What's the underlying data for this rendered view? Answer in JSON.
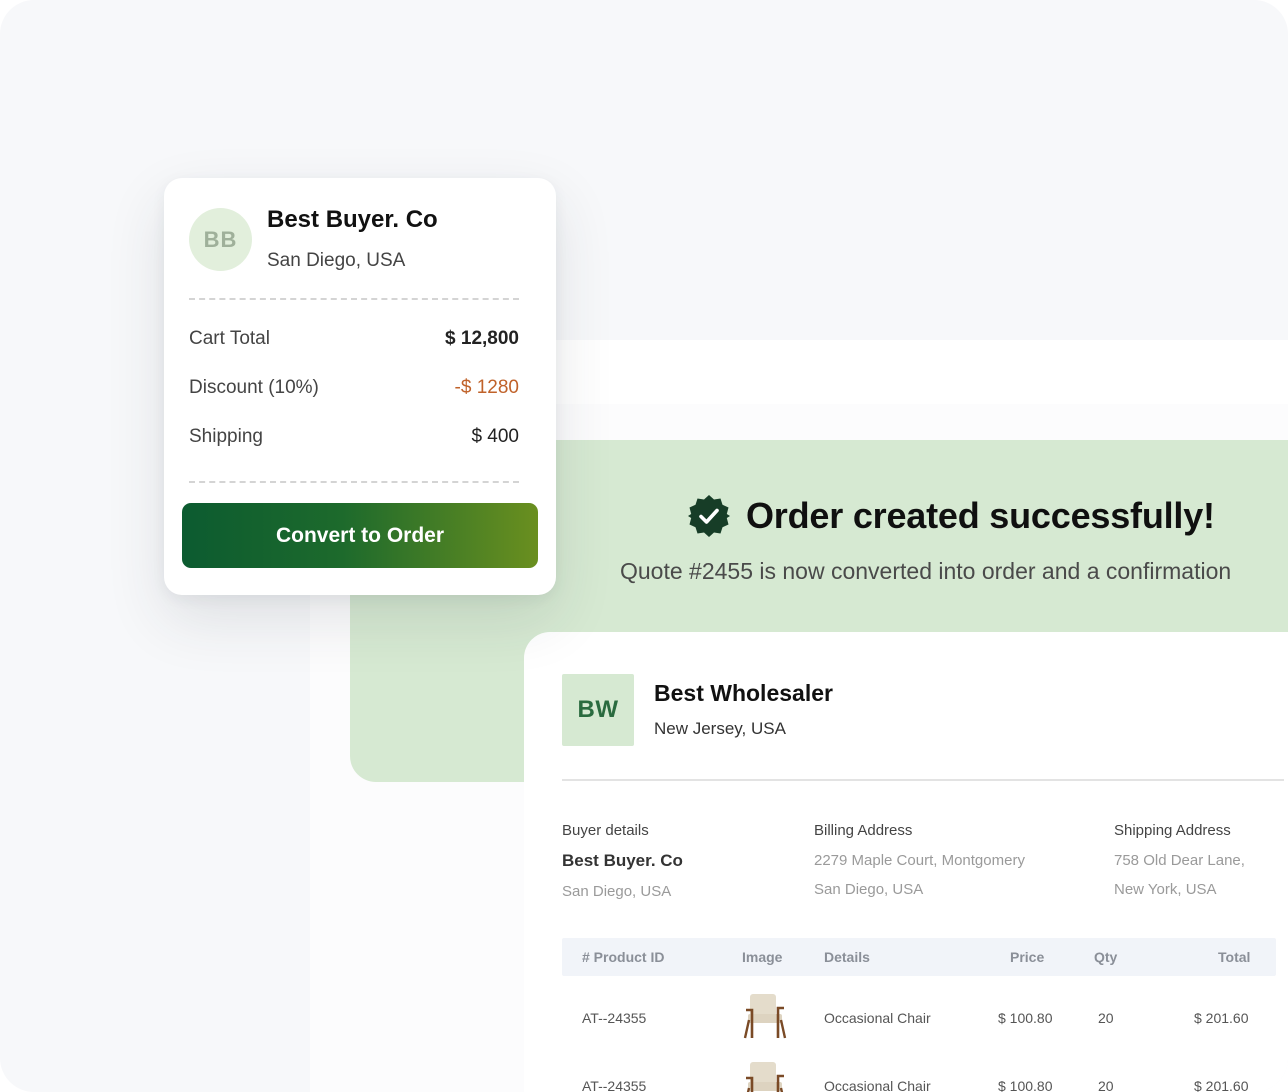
{
  "quote_card": {
    "avatar_initials": "BB",
    "buyer_name": "Best Buyer. Co",
    "buyer_location": "San Diego, USA",
    "rows": [
      {
        "label": "Cart Total",
        "value": "$ 12,800"
      },
      {
        "label": "Discount (10%)",
        "value": "-$ 1280"
      },
      {
        "label": "Shipping",
        "value": "$ 400"
      }
    ],
    "convert_button": "Convert to Order"
  },
  "banner": {
    "title": "Order created successfully!",
    "subtitle": "Quote #2455 is now converted into order and a confirmation",
    "icon": "verified-check-icon",
    "color": "#d6e9d2"
  },
  "invoice": {
    "seller_initials": "BW",
    "seller_name": "Best Wholesaler",
    "seller_location": "New Jersey, USA",
    "buyer_details": {
      "label": "Buyer details",
      "name": "Best Buyer. Co",
      "location": "San Diego, USA"
    },
    "billing_address": {
      "label": "Billing Address",
      "line1": "2279 Maple Court, Montgomery",
      "line2": "San Diego, USA"
    },
    "shipping_address": {
      "label": "Shipping Address",
      "line1": "758 Old Dear Lane,",
      "line2": "New York, USA"
    },
    "table": {
      "headers": [
        "# Product ID",
        "Image",
        "Details",
        "Price",
        "Qty",
        "Total"
      ],
      "rows": [
        {
          "product_id": "AT--24355",
          "image": "chair-image",
          "details": "Occasional Chair",
          "price": "$ 100.80",
          "qty": "20",
          "total": "$ 201.60"
        },
        {
          "product_id": "AT--24355",
          "image": "chair-image",
          "details": "Occasional Chair",
          "price": "$ 100.80",
          "qty": "20",
          "total": "$ 201.60"
        }
      ]
    }
  },
  "colors": {
    "accent_green": "#0c5b30",
    "discount": "#c0622a",
    "banner": "#d6e9d2"
  }
}
